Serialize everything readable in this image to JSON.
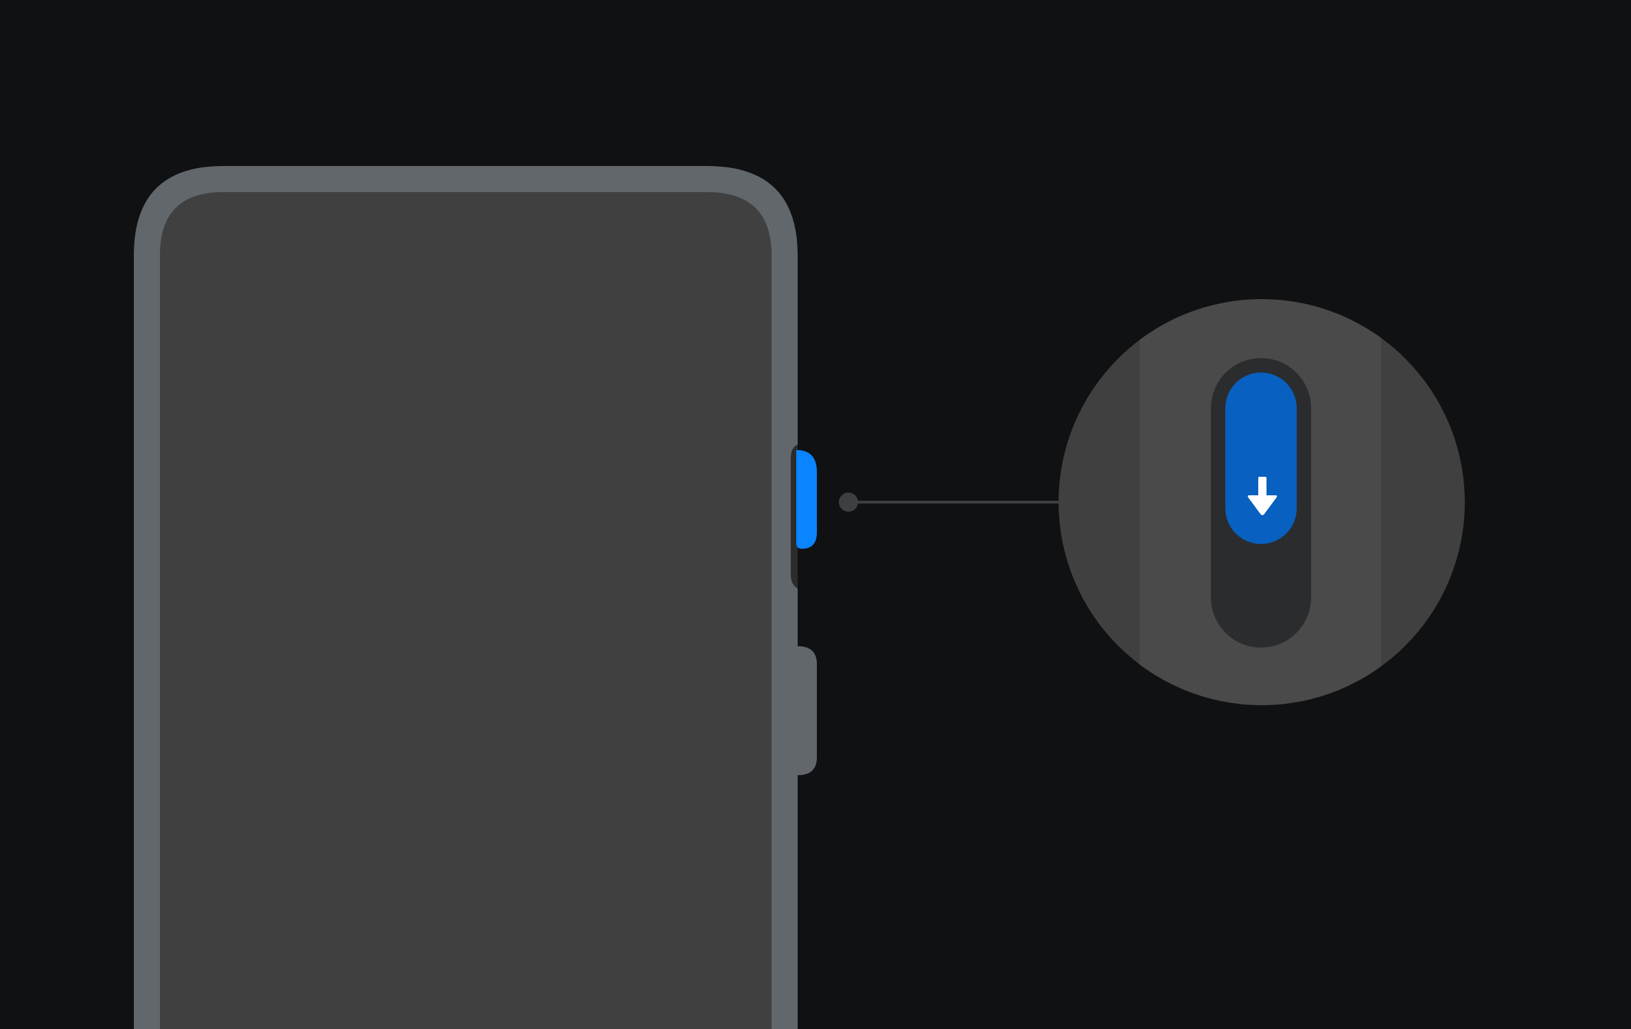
{
  "scene": {
    "description_visible_text": "",
    "colors": {
      "background": "#101113",
      "phone_frame": "#62676C",
      "phone_screen": "#404040",
      "button_recess": "#2B2C2E",
      "button_active": "#0A84FF",
      "button_active_zoomed": "#0860C0",
      "side_button": "#62676C",
      "connector": "#3E3F41",
      "magnifier_outer": "#404040",
      "magnifier_band": "#4A4A4B",
      "arrow": "#FFFFFF"
    },
    "icons": {
      "toggle_direction": "arrow-down-icon"
    },
    "switch": {
      "state": "down"
    }
  }
}
